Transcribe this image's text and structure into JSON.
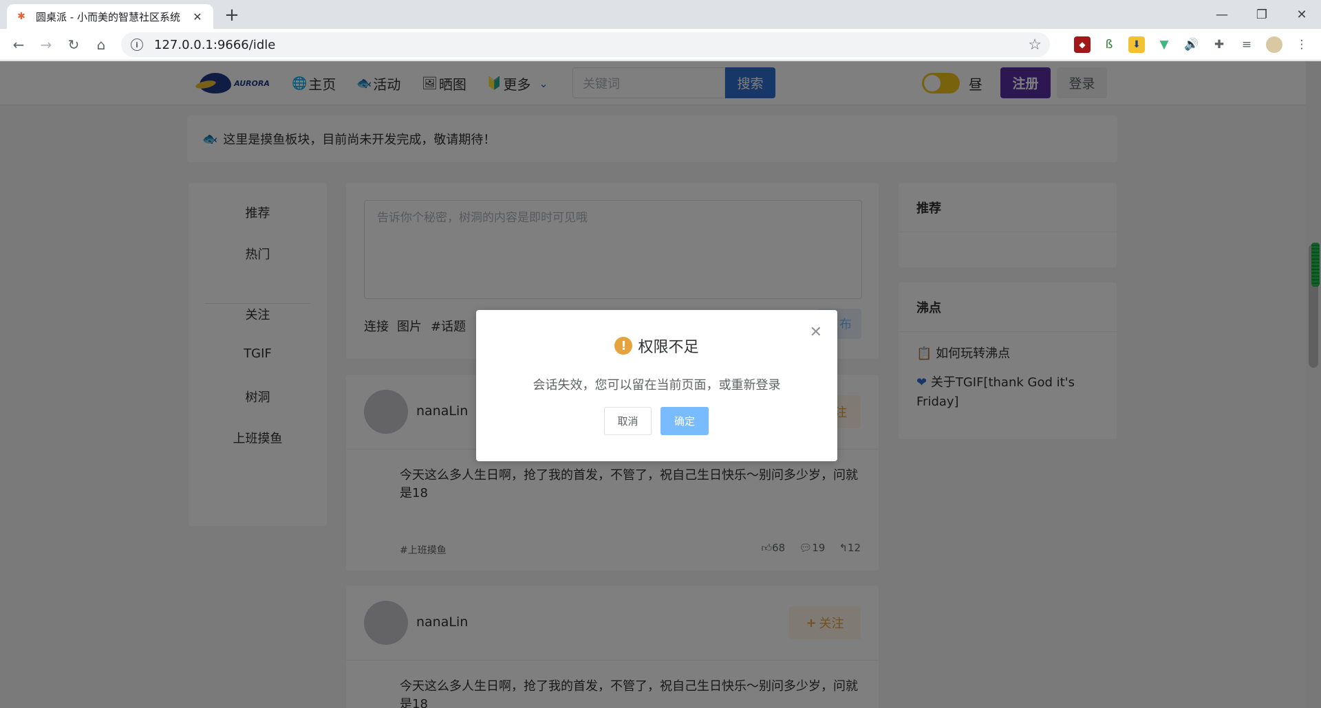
{
  "browser": {
    "tab_title": "圆桌派 - 小而美的智慧社区系统",
    "url": "127.0.0.1:9666/idle"
  },
  "site": {
    "logo_text": "AURORA",
    "nav": [
      {
        "label": "主页",
        "icon": "globe-icon"
      },
      {
        "label": "活动",
        "icon": "fish-icon"
      },
      {
        "label": "晒图",
        "icon": "image-icon"
      },
      {
        "label": "更多",
        "icon": "badge-icon"
      }
    ],
    "search_placeholder": "关键词",
    "search_label": "搜索",
    "theme_label": "昼",
    "register_label": "注册",
    "login_label": "登录"
  },
  "notice": "这里是摸鱼板块，目前尚未开发完成，敬请期待！",
  "leftnav": [
    "推荐",
    "热门",
    "关注",
    "TGIF",
    "树洞",
    "上班摸鱼"
  ],
  "composer": {
    "placeholder": "告诉你个秘密，树洞的内容是即时可见哦",
    "tools": [
      "连接",
      "图片",
      "#话题"
    ],
    "publish_label": "布"
  },
  "posts": [
    {
      "author": "nanaLin",
      "follow_label": "注",
      "content": "今天这么多人生日啊，抢了我的首发，不管了，祝自己生日快乐～别问多少岁，问就是18",
      "tag": "#上班摸鱼",
      "likes": "68",
      "comments": "19",
      "shares": "12"
    },
    {
      "author": "nanaLin",
      "follow_label": "关注",
      "content": "今天这么多人生日啊，抢了我的首发，不管了，祝自己生日快乐～别问多少岁，问就是18"
    }
  ],
  "sidebar": {
    "recommend_title": "推荐",
    "hot_title": "沸点",
    "hot_items": [
      "如何玩转沸点",
      "关于TGIF[thank God it's Friday]"
    ]
  },
  "dialog": {
    "title": "权限不足",
    "message": "会话失效，您可以留在当前页面，或重新登录",
    "cancel_label": "取消",
    "confirm_label": "确定"
  }
}
